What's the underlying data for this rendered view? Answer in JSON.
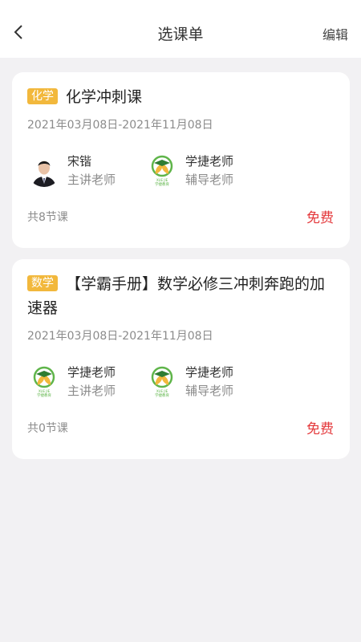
{
  "header": {
    "title": "选课单",
    "edit_label": "编辑"
  },
  "courses": [
    {
      "subject": "化学",
      "title": "化学冲刺课",
      "date_range": "2021年03月08日-2021年11月08日",
      "teachers": [
        {
          "name": "宋锴",
          "role": "主讲老师",
          "avatar": "person-photo"
        },
        {
          "name": "学捷老师",
          "role": "辅导老师",
          "avatar": "brand-logo"
        }
      ],
      "lesson_count": "共8节课",
      "price": "免费"
    },
    {
      "subject": "数学",
      "title": "【学霸手册】数学必修三冲刺奔跑的加速器",
      "date_range": "2021年03月08日-2021年11月08日",
      "teachers": [
        {
          "name": "学捷老师",
          "role": "主讲老师",
          "avatar": "brand-logo"
        },
        {
          "name": "学捷老师",
          "role": "辅导老师",
          "avatar": "brand-logo"
        }
      ],
      "lesson_count": "共0节课",
      "price": "免费"
    }
  ],
  "colors": {
    "tag": "#f2b83c",
    "price": "#e4393c",
    "background": "#f2f1f3"
  }
}
